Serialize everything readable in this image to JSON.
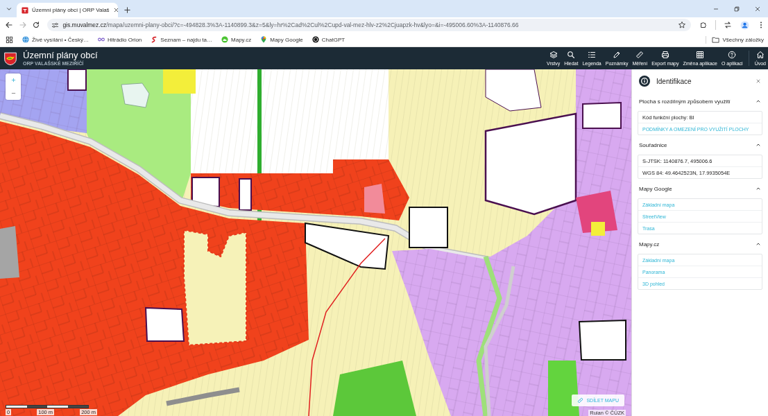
{
  "browser": {
    "tab": {
      "title": "Územní plány obcí | ORP Valaš",
      "selected": true
    },
    "forward_disabled": true,
    "url": {
      "host": "gis.muvalmez.cz",
      "path": "/mapa/uzemni-plany-obci/?c=-494828.3%3A-1140899.3&z=5&ly=hr%2Cad%2Cul%2Cupd-val-mez-hlv-z2%2Cjuapzk-hv&lyo=&i=-495006.60%3A-1140876.66"
    },
    "bookmarks": [
      {
        "label": "Živé vysílání • Český…"
      },
      {
        "label": "Hitrádio Orion"
      },
      {
        "label": "Seznam – najdu ta…"
      },
      {
        "label": "Mapy.cz"
      },
      {
        "label": "Mapy Google"
      },
      {
        "label": "ChatGPT"
      }
    ],
    "all_bookmarks": "Všechny záložky"
  },
  "app": {
    "title": "Územní plány obcí",
    "subtitle": "ORP VALAŠSKÉ MEZIŘÍČÍ",
    "tools": [
      {
        "label": "Vrstvy"
      },
      {
        "label": "Hledat"
      },
      {
        "label": "Legenda"
      },
      {
        "label": "Poznámky"
      },
      {
        "label": "Měření"
      },
      {
        "label": "Export mapy"
      },
      {
        "label": "Změna aplikace"
      },
      {
        "label": "O aplikaci"
      }
    ],
    "home": "Úvod"
  },
  "map": {
    "scale_labels": [
      "0",
      "100 m",
      "200 m"
    ],
    "share_button": "SDÍLET MAPU",
    "attribution": "Ruian © ČÚZK"
  },
  "panel": {
    "title": "Identifikace",
    "sections": [
      {
        "title": "Plocha s rozdílným způsobem využití",
        "expanded": true,
        "rows": [
          {
            "kind": "text",
            "text": "Kód funkční plochy: BI"
          },
          {
            "kind": "link",
            "text": "PODMÍNKY A OMEZENÍ PRO VYUŽITÍ PLOCHY"
          }
        ]
      },
      {
        "title": "Souřadnice",
        "expanded": true,
        "rows": [
          {
            "kind": "text",
            "text": "S-JTSK: 1140876.7, 495006.6"
          },
          {
            "kind": "text",
            "text": "WGS 84: 49.4642523N, 17.9935054E"
          }
        ]
      },
      {
        "title": "Mapy Google",
        "expanded": true,
        "rows": [
          {
            "kind": "link",
            "text": "Základní mapa"
          },
          {
            "kind": "link",
            "text": "StreetView"
          },
          {
            "kind": "link",
            "text": "Trasa"
          }
        ]
      },
      {
        "title": "Mapy.cz",
        "expanded": true,
        "rows": [
          {
            "kind": "link",
            "text": "Základní mapa"
          },
          {
            "kind": "link",
            "text": "Panorama"
          },
          {
            "kind": "link",
            "text": "3D pohled"
          }
        ]
      }
    ]
  }
}
